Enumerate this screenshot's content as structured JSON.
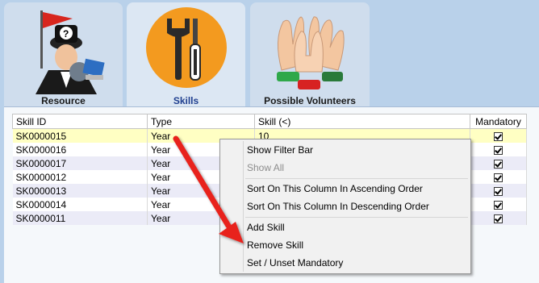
{
  "tabs": [
    {
      "label": "Resource",
      "icon": "resource-agent-icon",
      "active": false
    },
    {
      "label": "Skills",
      "icon": "tools-icon",
      "active": true
    },
    {
      "label": "Possible Volunteers",
      "icon": "raised-hands-icon",
      "active": false
    }
  ],
  "grid": {
    "headers": {
      "skill_id": "Skill ID",
      "type": "Type",
      "skill": "Skill (<)",
      "mandatory": "Mandatory"
    },
    "rows": [
      {
        "skill_id": "SK0000015",
        "type": "Year",
        "skill": "10",
        "mandatory": true,
        "selected": true
      },
      {
        "skill_id": "SK0000016",
        "type": "Year",
        "skill": "",
        "mandatory": true
      },
      {
        "skill_id": "SK0000017",
        "type": "Year",
        "skill": "",
        "mandatory": true
      },
      {
        "skill_id": "SK0000012",
        "type": "Year",
        "skill": "",
        "mandatory": true
      },
      {
        "skill_id": "SK0000013",
        "type": "Year",
        "skill": "",
        "mandatory": true
      },
      {
        "skill_id": "SK0000014",
        "type": "Year",
        "skill": "",
        "mandatory": true
      },
      {
        "skill_id": "SK0000011",
        "type": "Year",
        "skill": "",
        "mandatory": true
      }
    ]
  },
  "context_menu": {
    "items": [
      {
        "label": "Show Filter Bar",
        "enabled": true
      },
      {
        "label": "Show All",
        "enabled": false
      },
      {
        "label": "Sort On This Column In Ascending Order",
        "enabled": true
      },
      {
        "label": "Sort On This Column In Descending Order",
        "enabled": true
      },
      {
        "label": "Add Skill",
        "enabled": true
      },
      {
        "label": "Remove Skill",
        "enabled": true
      },
      {
        "label": "Set / Unset Mandatory",
        "enabled": true
      }
    ]
  },
  "colors": {
    "background": "#b9d1ea",
    "selected_row": "#ffffc3",
    "alt_row": "#ebebf7",
    "arrow": "#e8231c",
    "active_tab_label": "#1f3f8f"
  }
}
